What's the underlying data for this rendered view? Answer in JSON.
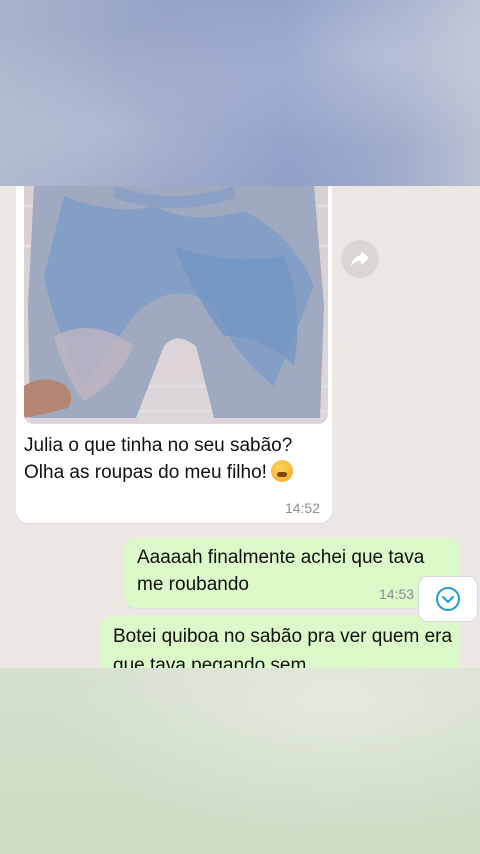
{
  "messages": {
    "incoming": {
      "text": "Julia o que tinha no seu sabão? Olha as roupas do meu filho!",
      "emoji": "tired-face-emoji",
      "time": "14:52",
      "attachment": "photo-of-stained-pants"
    },
    "outgoing_1": {
      "text": "Aaaaah finalmente achei que tava me roubando",
      "time": "14:53"
    },
    "outgoing_2": {
      "text": "Botei quiboa no sabão pra ver quem era que tava pegando sem"
    }
  },
  "controls": {
    "forward_icon": "forward-arrow-icon",
    "scroll_down_icon": "chevron-down-icon"
  },
  "colors": {
    "incoming_bubble": "#ffffff",
    "outgoing_bubble": "#dcf7c8",
    "chat_background": "#ece7e2",
    "accent": "#1d9bd7"
  }
}
